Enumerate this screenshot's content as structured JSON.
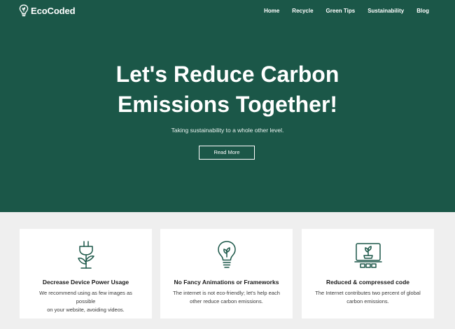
{
  "brand": {
    "name": "EcoCoded",
    "logo_icon": "lightbulb-leaf-icon"
  },
  "nav": {
    "items": [
      "Home",
      "Recycle",
      "Green Tips",
      "Sustainability",
      "Blog"
    ]
  },
  "hero": {
    "title_line1": "Let's Reduce Carbon",
    "title_line2": "Emissions Together!",
    "subtitle": "Taking sustainability to a whole other level.",
    "button_label": "Read More"
  },
  "features": [
    {
      "icon": "plug-leaf-icon",
      "title": "Decrease Device Power Usage",
      "desc_line1": "We recommend using as few images as possible",
      "desc_line2": "on your website, avoiding videos."
    },
    {
      "icon": "lightbulb-icon",
      "title": "No Fancy Animations or Frameworks",
      "desc_line1": "The internet is not eco-friendly; let's help each",
      "desc_line2": "other reduce carbon emissions."
    },
    {
      "icon": "monitor-plant-icon",
      "title": "Reduced & compressed code",
      "desc_line1": "The Internet contributes two percent of global",
      "desc_line2": "carbon emissions."
    }
  ],
  "colors": {
    "primary_green": "#1b5748",
    "page_background": "#efefef",
    "card_background": "#ffffff",
    "text_dark": "#1a1a1a"
  }
}
